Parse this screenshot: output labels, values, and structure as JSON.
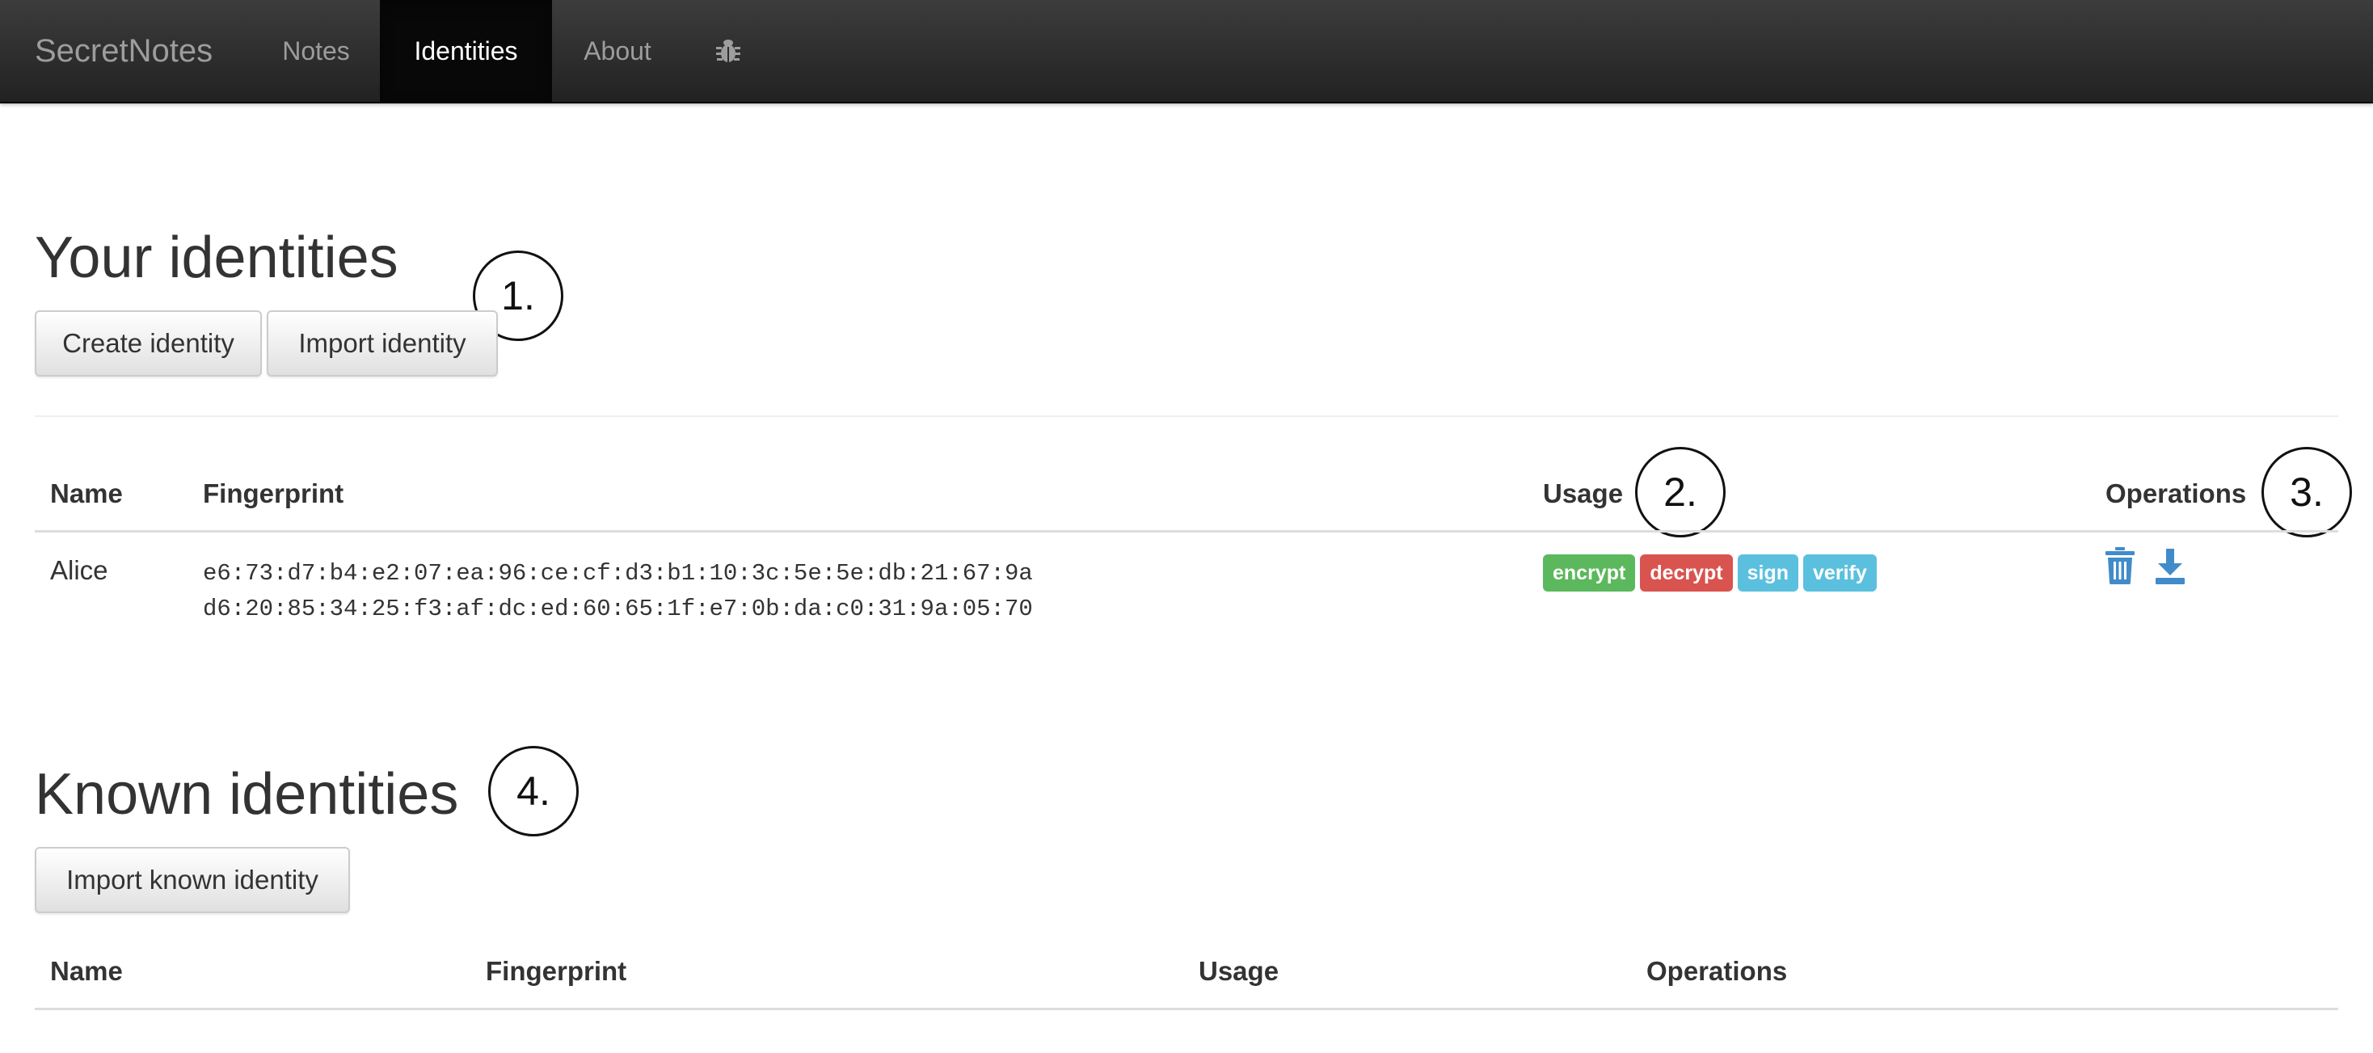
{
  "navbar": {
    "brand": "SecretNotes",
    "items": [
      {
        "label": "Notes"
      },
      {
        "label": "Identities"
      },
      {
        "label": "About"
      }
    ],
    "bug_icon": "bug-icon"
  },
  "your_identities": {
    "title": "Your identities",
    "buttons": {
      "create": "Create identity",
      "import": "Import identity"
    },
    "table": {
      "headers": {
        "name": "Name",
        "fingerprint": "Fingerprint",
        "usage": "Usage",
        "operations": "Operations"
      },
      "rows": [
        {
          "name": "Alice",
          "fingerprint_line1": "e6:73:d7:b4:e2:07:ea:96:ce:cf:d3:b1:10:3c:5e:5e:db:21:67:9a",
          "fingerprint_line2": "d6:20:85:34:25:f3:af:dc:ed:60:65:1f:e7:0b:da:c0:31:9a:05:70",
          "usage": [
            {
              "label": "encrypt",
              "color": "#5cb85c"
            },
            {
              "label": "decrypt",
              "color": "#d9534f"
            },
            {
              "label": "sign",
              "color": "#5bc0de"
            },
            {
              "label": "verify",
              "color": "#5bc0de"
            }
          ],
          "operations": [
            "trash-icon",
            "download-icon"
          ]
        }
      ]
    }
  },
  "known_identities": {
    "title": "Known identities",
    "buttons": {
      "import": "Import known identity"
    },
    "table": {
      "headers": {
        "name": "Name",
        "fingerprint": "Fingerprint",
        "usage": "Usage",
        "operations": "Operations"
      },
      "rows": []
    }
  },
  "annotations": [
    "1.",
    "2.",
    "3.",
    "4."
  ],
  "colors": {
    "navbar": "#222222",
    "icon_blue": "#428bca",
    "badge_success": "#5cb85c",
    "badge_danger": "#d9534f",
    "badge_info": "#5bc0de"
  }
}
